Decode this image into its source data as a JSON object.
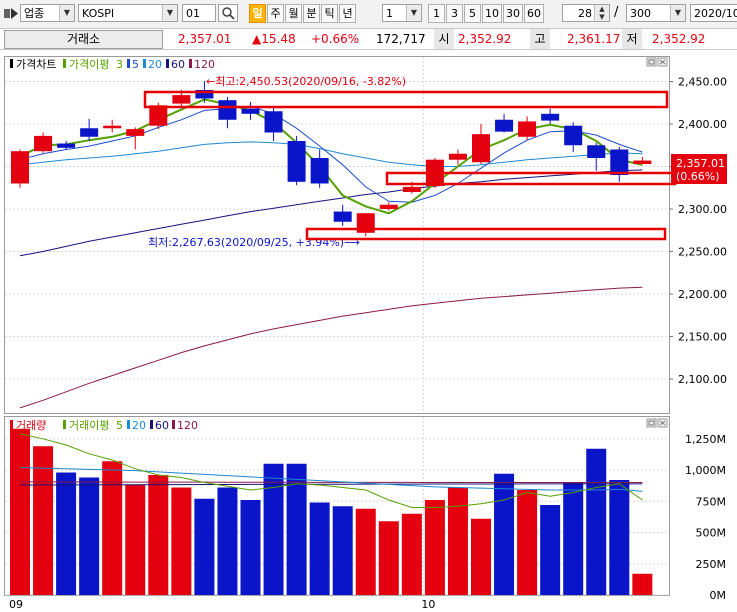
{
  "toolbar": {
    "menu_icon": "chart-menu-icon",
    "category": "업종",
    "index_name": "KOSPI",
    "code": "01",
    "search_icon": "magnifier-icon",
    "periods": [
      "일",
      "주",
      "월",
      "분",
      "틱",
      "년"
    ],
    "active_period": "일",
    "unit_value": "1",
    "intervals": [
      "1",
      "3",
      "5",
      "10",
      "30",
      "60"
    ],
    "count_value": "28",
    "separator": "/",
    "total_value": "300",
    "date_value": "2020/10/"
  },
  "summary": {
    "exchange_button": "거래소",
    "price": "2,357.01",
    "change": "▲15.48",
    "change_rate": "+0.66%",
    "volume": "172,717",
    "open_label": "시",
    "open_value": "2,352.92",
    "high_label": "고",
    "high_value": "2,361.17",
    "low_label": "저",
    "low_value": "2,352.92"
  },
  "colors": {
    "up": "#e4000f",
    "down": "#0a14c8",
    "ma3": "#55a000",
    "ma5": "#1c4ccc",
    "ma20": "#1a8ad4",
    "ma60": "#14147a",
    "ma120": "#8a1a4a",
    "highlight": "#e60000"
  },
  "price_panel": {
    "legend_title": "가격차트",
    "legend_ma_title": "가격이평",
    "legend_ma_periods": [
      "3",
      "5",
      "20",
      "60",
      "120"
    ],
    "high_annotation": "←최고:2,450.53(2020/09/16, -3.82%)",
    "low_annotation": "최저:2,267.63(2020/09/25, +3.94%)⟶",
    "current_price_tag": "2,357.01",
    "current_rate_tag": "(0.66%)",
    "y_ticks": [
      "2,450.00",
      "2,400.00",
      "2,350.00",
      "2,300.00",
      "2,250.00",
      "2,200.00",
      "2,150.00",
      "2,100.00"
    ]
  },
  "volume_panel": {
    "legend_title": "거래량",
    "legend_ma_title": "거래이평",
    "legend_ma_periods": [
      "5",
      "20",
      "60",
      "120"
    ],
    "y_ticks": [
      "1,250M",
      "1,000M",
      "750M",
      "500M",
      "250M",
      "0M"
    ]
  },
  "x_axis": {
    "labels": [
      "09",
      "10"
    ]
  },
  "chart_data": {
    "type": "candlestick",
    "dates": [
      "2020/09/04",
      "2020/09/07",
      "2020/09/08",
      "2020/09/09",
      "2020/09/10",
      "2020/09/11",
      "2020/09/14",
      "2020/09/15",
      "2020/09/16",
      "2020/09/17",
      "2020/09/18",
      "2020/09/21",
      "2020/09/22",
      "2020/09/23",
      "2020/09/24",
      "2020/09/25",
      "2020/09/28",
      "2020/09/29",
      "2020/10/05",
      "2020/10/06",
      "2020/10/07",
      "2020/10/08",
      "2020/10/12",
      "2020/10/13",
      "2020/10/14",
      "2020/10/15",
      "2020/10/16",
      "2020/10/19"
    ],
    "ohlc": [
      [
        2330,
        2370,
        2325,
        2368
      ],
      [
        2368,
        2390,
        2366,
        2386
      ],
      [
        2377,
        2380,
        2370,
        2372
      ],
      [
        2395,
        2406,
        2380,
        2385
      ],
      [
        2395,
        2405,
        2390,
        2398
      ],
      [
        2386,
        2396,
        2370,
        2394
      ],
      [
        2398,
        2425,
        2394,
        2422
      ],
      [
        2424,
        2440,
        2420,
        2434
      ],
      [
        2440,
        2450.53,
        2425,
        2430
      ],
      [
        2428,
        2432,
        2395,
        2405
      ],
      [
        2418,
        2426,
        2405,
        2412
      ],
      [
        2415,
        2420,
        2380,
        2390
      ],
      [
        2380,
        2386,
        2328,
        2332
      ],
      [
        2360,
        2370,
        2325,
        2330
      ],
      [
        2297,
        2305,
        2280,
        2285
      ],
      [
        2272,
        2295,
        2267.63,
        2295
      ],
      [
        2300,
        2308,
        2298,
        2305
      ],
      [
        2320,
        2332,
        2318,
        2326
      ],
      [
        2327,
        2360,
        2325,
        2358
      ],
      [
        2358,
        2370,
        2352,
        2365
      ],
      [
        2355,
        2400,
        2353,
        2388
      ],
      [
        2405,
        2412,
        2390,
        2391
      ],
      [
        2385,
        2409,
        2381,
        2403
      ],
      [
        2412,
        2418,
        2400,
        2404
      ],
      [
        2398,
        2402,
        2367,
        2375
      ],
      [
        2375,
        2378,
        2345,
        2360
      ],
      [
        2370,
        2373,
        2332,
        2340
      ],
      [
        2352.92,
        2361.17,
        2352.92,
        2357.01
      ]
    ],
    "volume_m": [
      1330,
      1190,
      980,
      940,
      1070,
      880,
      960,
      860,
      770,
      860,
      760,
      1050,
      1050,
      740,
      710,
      690,
      590,
      650,
      760,
      860,
      610,
      970,
      840,
      720,
      900,
      1170,
      920,
      170
    ],
    "ma3": [
      2362,
      2375,
      2376,
      2381,
      2385,
      2392,
      2405,
      2417,
      2429,
      2423,
      2416,
      2402,
      2378,
      2350,
      2316,
      2303,
      2295,
      2309,
      2330,
      2350,
      2370,
      2381,
      2394,
      2399,
      2394,
      2380,
      2358,
      2352
    ],
    "ma5": [
      2358,
      2365,
      2370,
      2374,
      2380,
      2386,
      2396,
      2405,
      2416,
      2418,
      2421,
      2412,
      2395,
      2374,
      2352,
      2326,
      2309,
      2308,
      2316,
      2330,
      2348,
      2366,
      2381,
      2391,
      2392,
      2387,
      2376,
      2367
    ],
    "ma20": [
      2352,
      2355,
      2358,
      2360,
      2362,
      2365,
      2368,
      2372,
      2376,
      2378,
      2379,
      2378,
      2376,
      2371,
      2365,
      2360,
      2355,
      2352,
      2350,
      2350,
      2352,
      2355,
      2358,
      2360,
      2362,
      2364,
      2366,
      2365
    ],
    "ma60": [
      2245,
      2250,
      2256,
      2262,
      2267,
      2272,
      2277,
      2282,
      2287,
      2292,
      2297,
      2301,
      2305,
      2309,
      2313,
      2317,
      2320,
      2324,
      2327,
      2330,
      2332,
      2335,
      2337,
      2339,
      2341,
      2343,
      2345,
      2346
    ],
    "ma120": [
      2066,
      2075,
      2085,
      2095,
      2104,
      2113,
      2122,
      2131,
      2139,
      2146,
      2153,
      2159,
      2164,
      2169,
      2174,
      2178,
      2182,
      2186,
      2189,
      2192,
      2195,
      2197,
      2199,
      2201,
      2203,
      2205,
      2207,
      2208
    ],
    "vol_ma5": [
      1290,
      1250,
      1200,
      1130,
      1080,
      1010,
      960,
      940,
      900,
      870,
      840,
      860,
      890,
      880,
      860,
      840,
      760,
      700,
      700,
      710,
      730,
      760,
      820,
      790,
      820,
      860,
      890,
      760
    ],
    "vol_ma20": [
      1020,
      1015,
      1010,
      1005,
      1000,
      995,
      985,
      975,
      965,
      955,
      945,
      935,
      925,
      915,
      905,
      895,
      885,
      875,
      865,
      860,
      855,
      850,
      845,
      840,
      840,
      840,
      845,
      830
    ],
    "vol_ma60": [
      880,
      880,
      881,
      881,
      882,
      882,
      883,
      883,
      884,
      884,
      885,
      885,
      886,
      886,
      886,
      887,
      887,
      887,
      888,
      888,
      888,
      888,
      889,
      889,
      889,
      889,
      889,
      889
    ],
    "vol_ma120": [
      905,
      905,
      904,
      904,
      904,
      903,
      903,
      903,
      903,
      902,
      902,
      902,
      902,
      901,
      901,
      901,
      901,
      901,
      900,
      900,
      900,
      900,
      900,
      900,
      900,
      900,
      900,
      900
    ],
    "price_ylim": [
      2060,
      2480
    ],
    "volume_ylim": [
      0,
      1400
    ],
    "grid": true,
    "highlight_boxes": [
      "high-region",
      "low-region",
      "current-price-region"
    ]
  }
}
